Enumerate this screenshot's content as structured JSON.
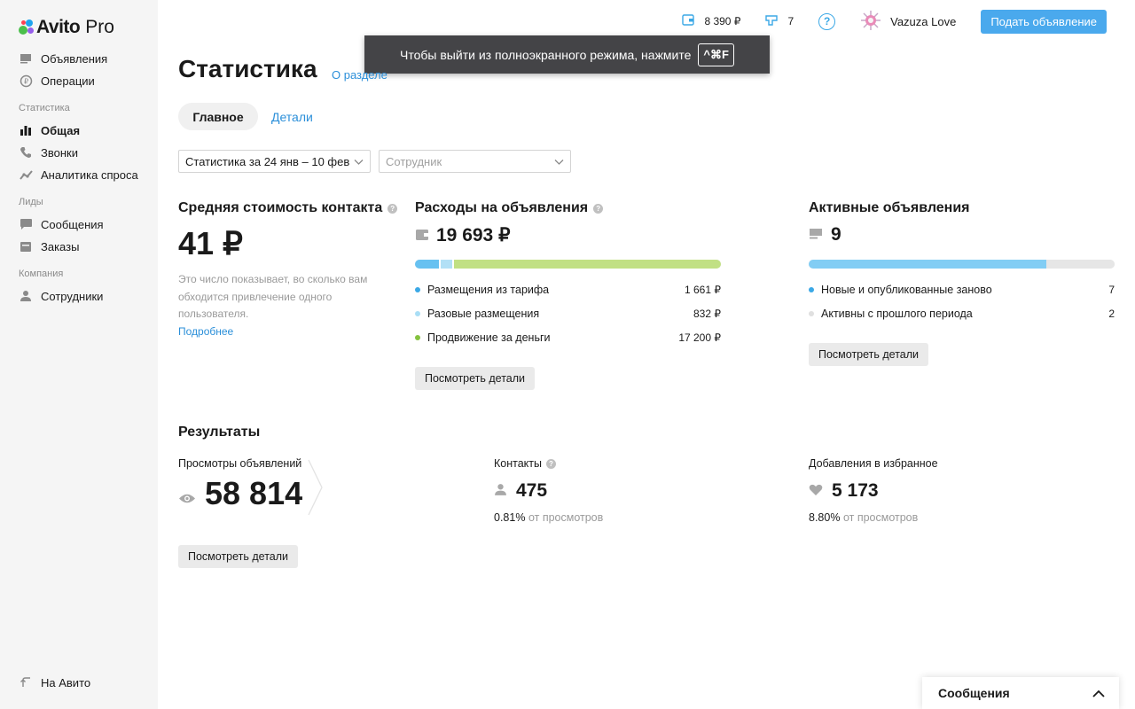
{
  "brand": {
    "name": "Avito",
    "suffix": "Pro"
  },
  "sidebar": {
    "items_top": [
      {
        "label": "Объявления",
        "icon": "listing-icon"
      },
      {
        "label": "Операции",
        "icon": "operations-icon"
      }
    ],
    "section_stats": "Статистика",
    "items_stats": [
      {
        "label": "Общая",
        "icon": "bar-chart-icon",
        "active": true
      },
      {
        "label": "Звонки",
        "icon": "phone-icon"
      },
      {
        "label": "Аналитика спроса",
        "icon": "trend-icon"
      }
    ],
    "section_leads": "Лиды",
    "items_leads": [
      {
        "label": "Сообщения",
        "icon": "chat-icon"
      },
      {
        "label": "Заказы",
        "icon": "orders-icon"
      }
    ],
    "section_company": "Компания",
    "items_company": [
      {
        "label": "Сотрудники",
        "icon": "user-icon"
      }
    ],
    "back_link": "На Авито"
  },
  "topbar": {
    "wallet": "8 390 ₽",
    "listings_count": "7",
    "help": "?",
    "user_name": "Vazuza Love",
    "post_button": "Подать объявление"
  },
  "overlay": {
    "text": "Чтобы выйти из полноэкранного режима, нажмите",
    "key": "^⌘F"
  },
  "page": {
    "title": "Статистика",
    "about_link": "О разделе",
    "tabs": [
      "Главное",
      "Детали"
    ],
    "filters": {
      "period": "Статистика за 24 янв – 10 фев",
      "employee_placeholder": "Сотрудник"
    }
  },
  "contact_cost": {
    "title": "Средняя стоимость контакта",
    "value": "41 ₽",
    "description": "Это число показывает, во сколько вам обходится привлечение одного пользователя.",
    "more_link": "Подробнее"
  },
  "expenses": {
    "title": "Расходы на объявления",
    "total": "19 693 ₽",
    "segments": [
      {
        "label": "Размещения из тарифа",
        "value": "1 661 ₽",
        "amount": 1661,
        "color": "#67c1f1"
      },
      {
        "label": "Разовые размещения",
        "value": "832 ₽",
        "amount": 832,
        "color": "#b2e0f6"
      },
      {
        "label": "Продвижение за деньги",
        "value": "17 200 ₽",
        "amount": 17200,
        "color": "#c1e084"
      }
    ],
    "legend_dot_colors": [
      "#3ba8e6",
      "#a9def5",
      "#85c23f"
    ],
    "button": "Посмотреть детали"
  },
  "active_listings": {
    "title": "Активные объявления",
    "total": "9",
    "segments": [
      {
        "label": "Новые и опубликованные заново",
        "value": "7",
        "amount": 7,
        "color": "#82cdf4"
      },
      {
        "label": "Активны с прошлого периода",
        "value": "2",
        "amount": 2,
        "color": "#e6e6e6"
      }
    ],
    "legend_dot_colors": [
      "#3ba8e6",
      "#e0e0e0"
    ],
    "button": "Посмотреть детали"
  },
  "results": {
    "title": "Результаты",
    "views": {
      "label": "Просмотры объявлений",
      "value": "58 814"
    },
    "contacts": {
      "label": "Контакты",
      "value": "475",
      "ratio": "0.81%",
      "ratio_suffix": "от просмотров"
    },
    "favorites": {
      "label": "Добавления в избранное",
      "value": "5 173",
      "ratio": "8.80%",
      "ratio_suffix": "от просмотров"
    },
    "button": "Посмотреть детали"
  },
  "chat_widget": {
    "title": "Сообщения"
  }
}
